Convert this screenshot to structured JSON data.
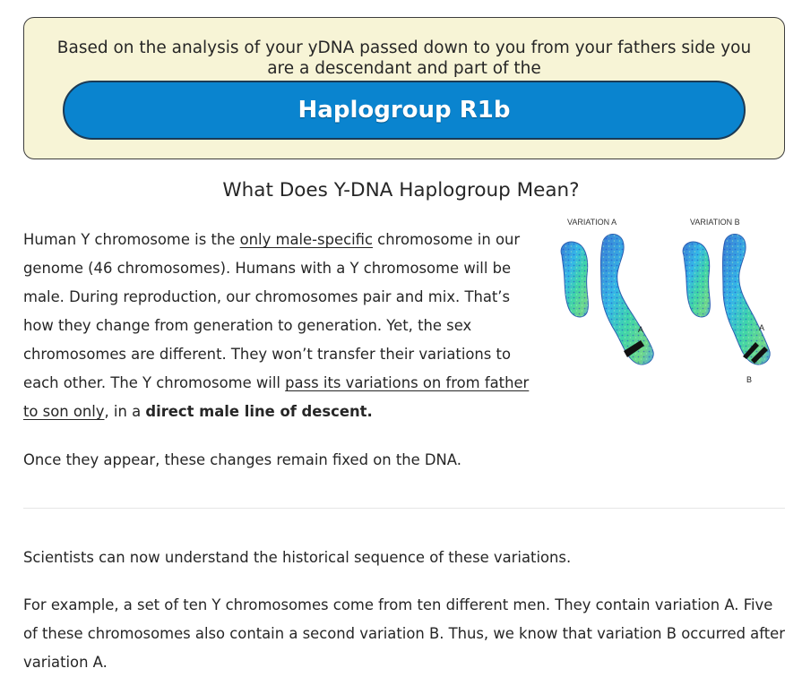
{
  "banner": {
    "text": "Based on the analysis of your yDNA passed down to you from your fathers side you are a descendant and part of the",
    "button_label": "Haplogroup R1b"
  },
  "heading": "What Does Y-DNA Haplogroup Mean?",
  "para1": {
    "t1": "Human Y chromosome is the ",
    "link1": "only male-specific",
    "t2": " chromosome in our genome (46 chromosomes). Humans with a Y chromosome will be male. During reproduction, our chromosomes pair and mix. That’s how they change from generation to generation. Yet, the sex chromosomes are different. They won’t transfer their variations to each other. The Y chromosome will ",
    "link2": "pass its variations on from father to son only",
    "t3": ", in a ",
    "bold": "direct male line of descent."
  },
  "para_once": "Once they appear, these changes remain fixed on the DNA.",
  "para_sci": "Scientists can now understand the historical sequence of these variations.",
  "para_ex": "For example, a set of ten Y chromosomes come from ten different men. They contain variation A. Five of these chromosomes also contain a second variation B. Thus, we know that variation B occurred after variation A.",
  "illustration": {
    "label_a": "VARIATION A",
    "label_b": "VARIATION B",
    "mark_a1": "A",
    "mark_a2": "A",
    "mark_b": "B"
  },
  "colors": {
    "banner_bg": "#f7f4d6",
    "button_bg": "#0a84cf",
    "text": "#262626"
  }
}
